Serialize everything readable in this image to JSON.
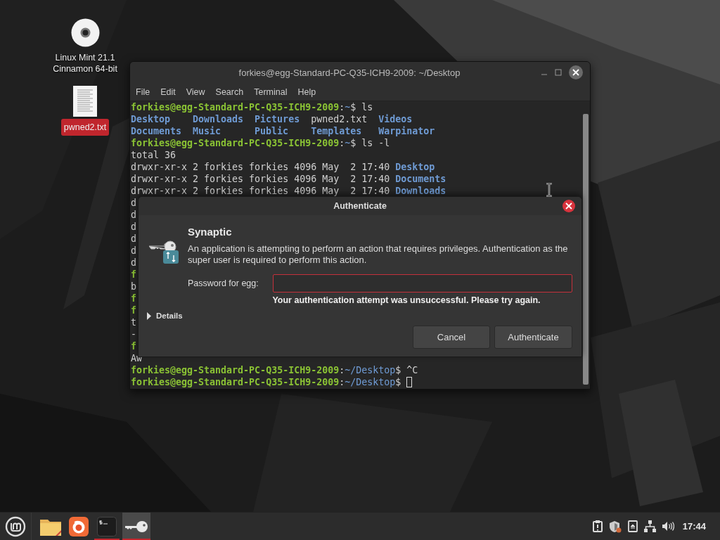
{
  "desktop_icons": [
    {
      "label": "Linux Mint 21.1 Cinnamon 64-bit",
      "kind": "disc",
      "selected": false
    },
    {
      "label": "pwned2.txt",
      "kind": "document",
      "selected": true
    }
  ],
  "terminal": {
    "title": "forkies@egg-Standard-PC-Q35-ICH9-2009: ~/Desktop",
    "menu": [
      "File",
      "Edit",
      "View",
      "Search",
      "Terminal",
      "Help"
    ],
    "lines": [
      {
        "kind": "text",
        "cursor": false,
        "segments": [
          {
            "kind": "user",
            "text": "forkies@egg-Standard-PC-Q35-ICH9-2009"
          },
          {
            "kind": "plain",
            "text": ":"
          },
          {
            "kind": "path",
            "text": "~"
          },
          {
            "kind": "plain",
            "text": "$ ls"
          }
        ]
      },
      {
        "kind": "columns",
        "cursor": false,
        "entries": [
          {
            "kind": "dir",
            "text": "Desktop"
          },
          {
            "kind": "dir",
            "text": "Downloads"
          },
          {
            "kind": "dir",
            "text": "Pictures"
          },
          {
            "kind": "file",
            "text": "pwned2.txt"
          },
          {
            "kind": "dir",
            "text": "Videos"
          }
        ]
      },
      {
        "kind": "columns",
        "cursor": false,
        "entries": [
          {
            "kind": "dir",
            "text": "Documents"
          },
          {
            "kind": "dir",
            "text": "Music"
          },
          {
            "kind": "dir",
            "text": "Public"
          },
          {
            "kind": "dir",
            "text": "Templates"
          },
          {
            "kind": "dir",
            "text": "Warpinator"
          }
        ]
      },
      {
        "kind": "text",
        "cursor": false,
        "segments": [
          {
            "kind": "user",
            "text": "forkies@egg-Standard-PC-Q35-ICH9-2009"
          },
          {
            "kind": "plain",
            "text": ":"
          },
          {
            "kind": "path",
            "text": "~"
          },
          {
            "kind": "plain",
            "text": "$ ls -l"
          }
        ]
      },
      {
        "kind": "text",
        "cursor": false,
        "segments": [
          {
            "kind": "plain",
            "text": "total 36"
          }
        ]
      },
      {
        "kind": "text",
        "cursor": false,
        "segments": [
          {
            "kind": "plain",
            "text": "drwxr-xr-x 2 forkies forkies 4096 May  2 17:40 "
          },
          {
            "kind": "dir",
            "text": "Desktop"
          }
        ]
      },
      {
        "kind": "text",
        "cursor": false,
        "segments": [
          {
            "kind": "plain",
            "text": "drwxr-xr-x 2 forkies forkies 4096 May  2 17:40 "
          },
          {
            "kind": "dir",
            "text": "Documents"
          }
        ]
      },
      {
        "kind": "text",
        "cursor": false,
        "segments": [
          {
            "kind": "plain",
            "text": "drwxr-xr-x 2 forkies forkies 4096 May  2 17:40 "
          },
          {
            "kind": "dir",
            "text": "Downloads"
          }
        ]
      },
      {
        "kind": "text",
        "cursor": false,
        "segments": [
          {
            "kind": "plain",
            "text": "d"
          }
        ]
      },
      {
        "kind": "text",
        "cursor": false,
        "segments": [
          {
            "kind": "plain",
            "text": "d"
          }
        ]
      },
      {
        "kind": "text",
        "cursor": false,
        "segments": [
          {
            "kind": "plain",
            "text": "d"
          }
        ]
      },
      {
        "kind": "text",
        "cursor": false,
        "segments": [
          {
            "kind": "plain",
            "text": "d"
          }
        ]
      },
      {
        "kind": "text",
        "cursor": false,
        "segments": [
          {
            "kind": "plain",
            "text": "d"
          }
        ]
      },
      {
        "kind": "text",
        "cursor": false,
        "segments": [
          {
            "kind": "plain",
            "text": "d"
          }
        ]
      },
      {
        "kind": "text",
        "cursor": false,
        "segments": [
          {
            "kind": "user",
            "text": "f"
          }
        ]
      },
      {
        "kind": "text",
        "cursor": false,
        "segments": [
          {
            "kind": "plain",
            "text": "b"
          }
        ]
      },
      {
        "kind": "text",
        "cursor": false,
        "segments": [
          {
            "kind": "user",
            "text": "f"
          }
        ]
      },
      {
        "kind": "text",
        "cursor": false,
        "segments": [
          {
            "kind": "user",
            "text": "f"
          }
        ]
      },
      {
        "kind": "text",
        "cursor": false,
        "segments": [
          {
            "kind": "plain",
            "text": "t"
          }
        ]
      },
      {
        "kind": "text",
        "cursor": false,
        "segments": [
          {
            "kind": "plain",
            "text": "-"
          }
        ]
      },
      {
        "kind": "text",
        "cursor": false,
        "segments": [
          {
            "kind": "user",
            "text": "f"
          }
        ]
      },
      {
        "kind": "text",
        "cursor": false,
        "segments": [
          {
            "kind": "plain",
            "text": "Aw"
          }
        ]
      },
      {
        "kind": "text",
        "cursor": false,
        "segments": [
          {
            "kind": "user",
            "text": "forkies@egg-Standard-PC-Q35-ICH9-2009"
          },
          {
            "kind": "plain",
            "text": ":"
          },
          {
            "kind": "path",
            "text": "~/Desktop"
          },
          {
            "kind": "plain",
            "text": "$ ^C"
          }
        ]
      },
      {
        "kind": "text",
        "cursor": true,
        "segments": [
          {
            "kind": "user",
            "text": "forkies@egg-Standard-PC-Q35-ICH9-2009"
          },
          {
            "kind": "plain",
            "text": ":"
          },
          {
            "kind": "path",
            "text": "~/Desktop"
          },
          {
            "kind": "plain",
            "text": "$ "
          }
        ]
      }
    ]
  },
  "dialog": {
    "title": "Authenticate",
    "heading": "Synaptic",
    "message": "An application is attempting to perform an action that requires privileges. Authentication as the super user is required to perform this action.",
    "password_label": "Password for egg:",
    "password_error": true,
    "error_message": "Your authentication attempt was unsuccessful. Please try again.",
    "details": {
      "label": "Details",
      "expanded": false
    },
    "buttons": [
      "Cancel",
      "Authenticate"
    ]
  },
  "taskbar": {
    "apps": [
      {
        "kind": "files",
        "running": false,
        "selected": false
      },
      {
        "kind": "browser",
        "running": false,
        "selected": false
      },
      {
        "kind": "terminal",
        "running": true,
        "selected": false
      },
      {
        "kind": "key",
        "running": true,
        "selected": true
      }
    ],
    "clock": "17:44"
  }
}
